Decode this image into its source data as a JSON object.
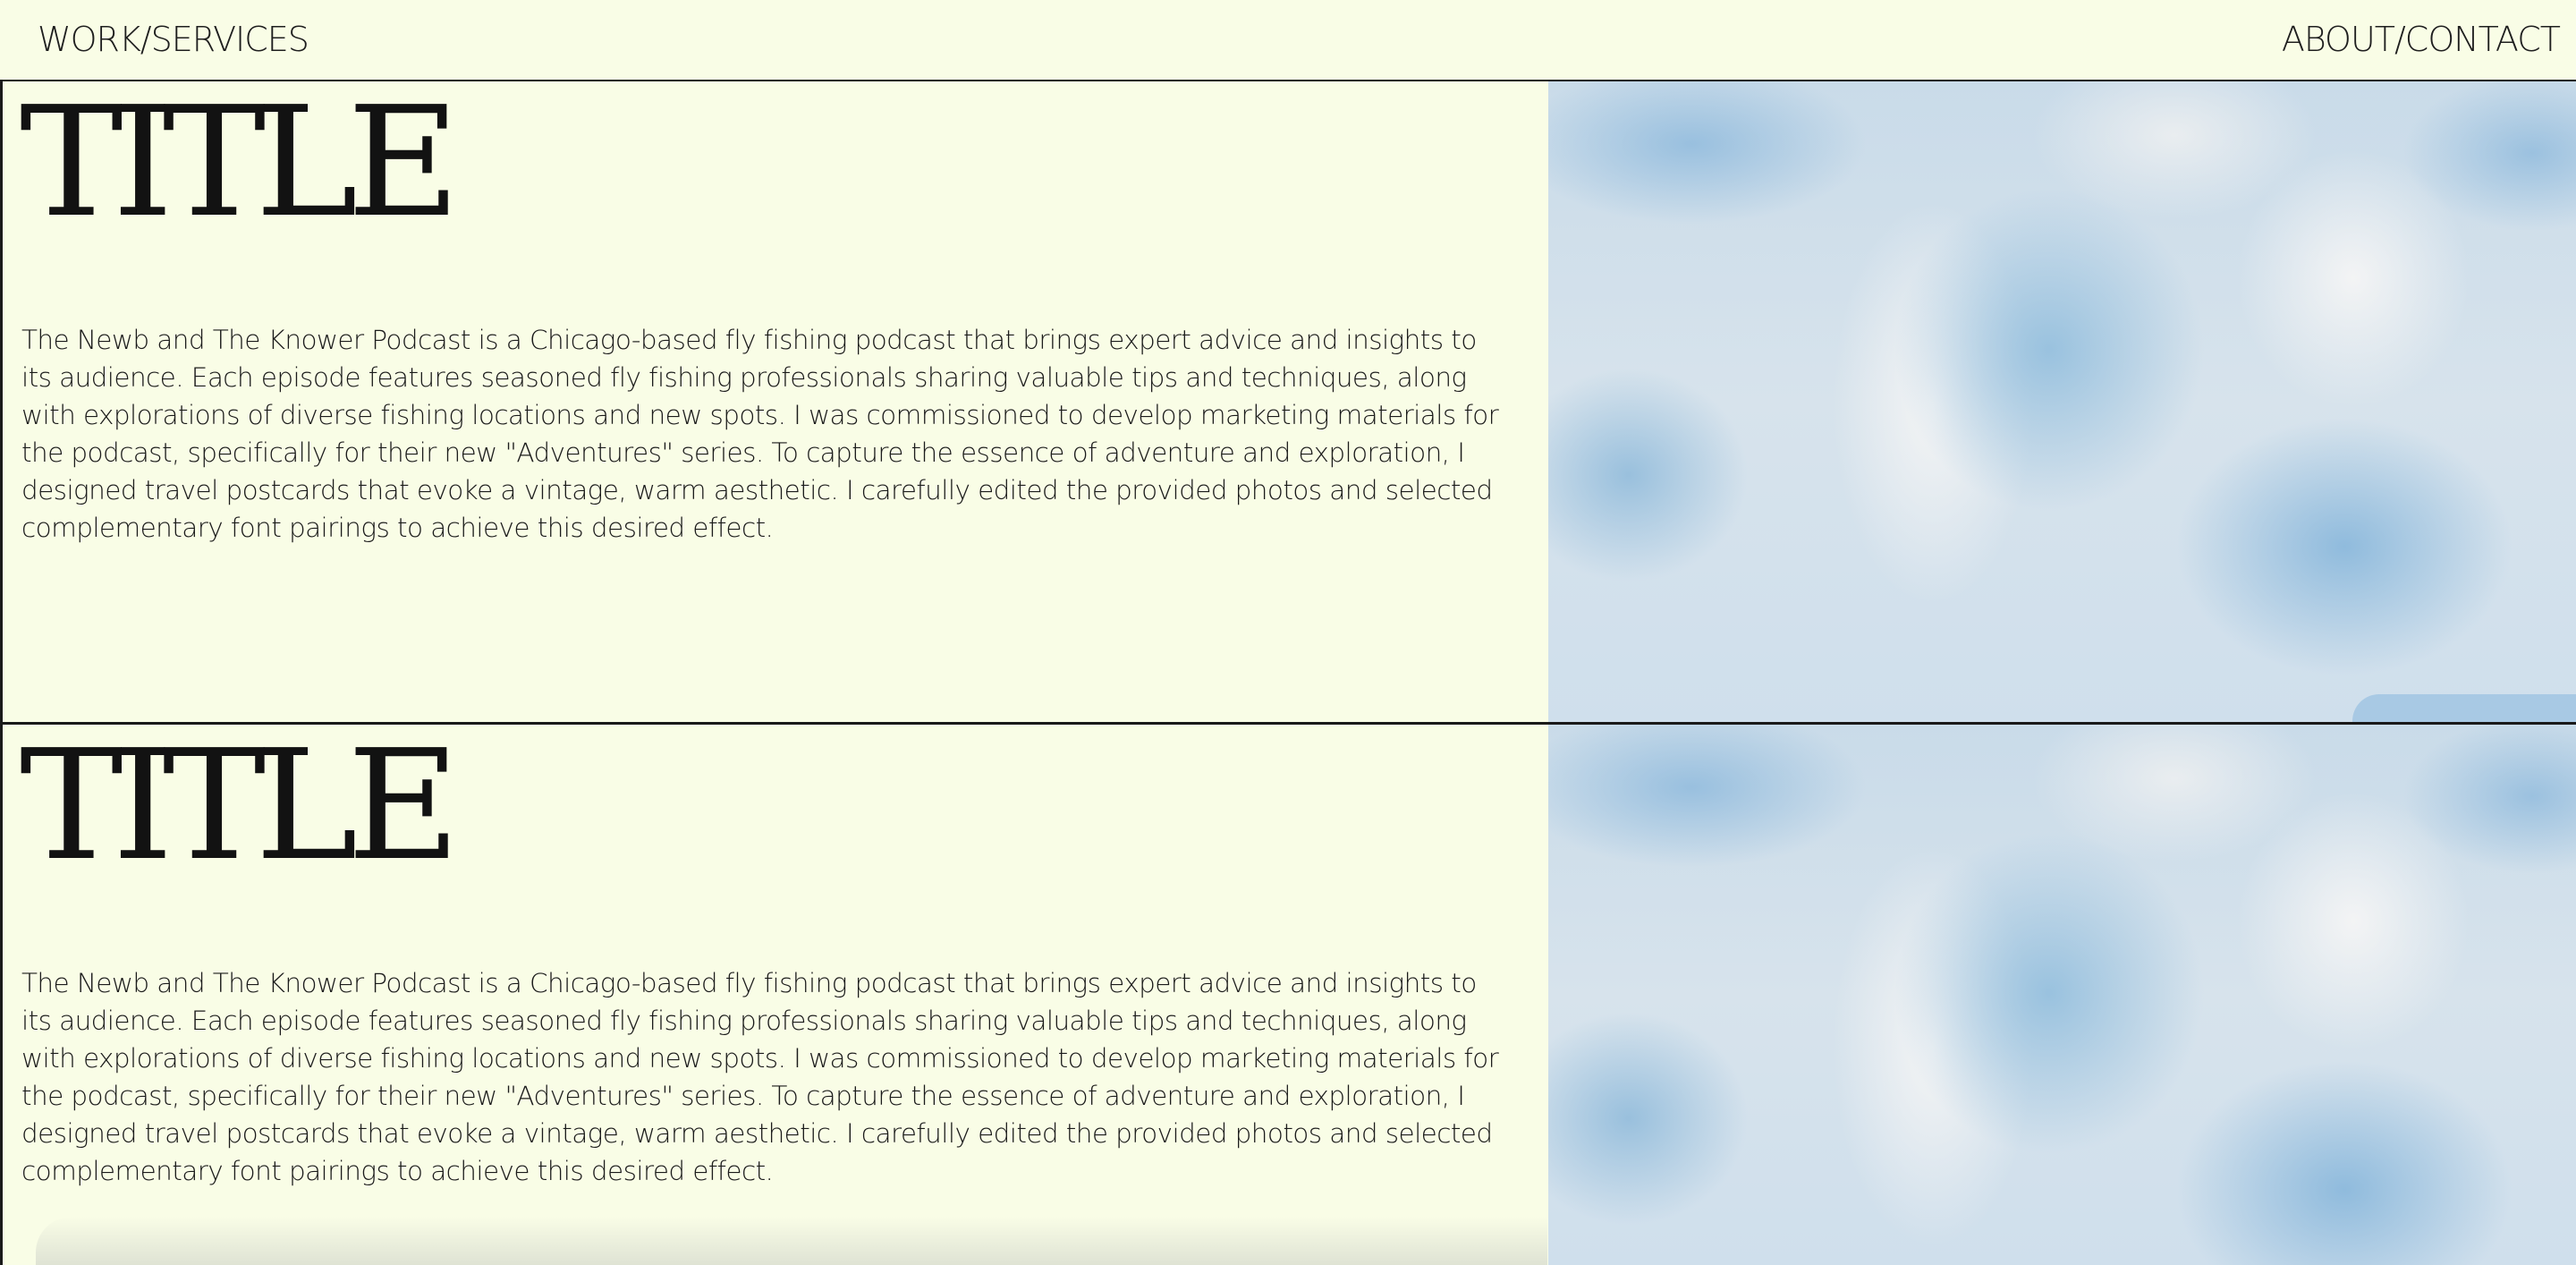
{
  "nav": {
    "left_label": "WORK/SERVICES",
    "right_label": "ABOUT/CONTACT"
  },
  "projects": [
    {
      "title": "TITLE",
      "description": "The Newb and The Knower Podcast is a Chicago-based fly fishing podcast that brings expert advice and insights to its audience. Each episode features seasoned fly fishing professionals sharing valuable tips and techniques, along with explorations of diverse fishing locations and new spots. I was commissioned to develop marketing materials for the podcast, specifically for their new \"Adventures\" series. To capture the essence of adventure and exploration, I designed travel postcards that evoke a vintage, warm aesthetic. I carefully edited the provided photos and selected complementary font pairings to achieve this desired effect."
    },
    {
      "title": "TITLE",
      "description": "The Newb and The Knower Podcast is a Chicago-based fly fishing podcast that brings expert advice and insights to its audience. Each episode features seasoned fly fishing professionals sharing valuable tips and techniques, along with explorations of diverse fishing locations and new spots. I was commissioned to develop marketing materials for the podcast, specifically for their new \"Adventures\" series. To capture the essence of adventure and exploration, I designed travel postcards that evoke a vintage, warm aesthetic. I carefully edited the provided photos and selected complementary font pairings to achieve this desired effect."
    }
  ],
  "colors": {
    "background": "#f9fde6",
    "text": "#121212",
    "rule": "#1a1a1a",
    "image_blue": "#96bede",
    "image_light": "#f0f1f2"
  }
}
